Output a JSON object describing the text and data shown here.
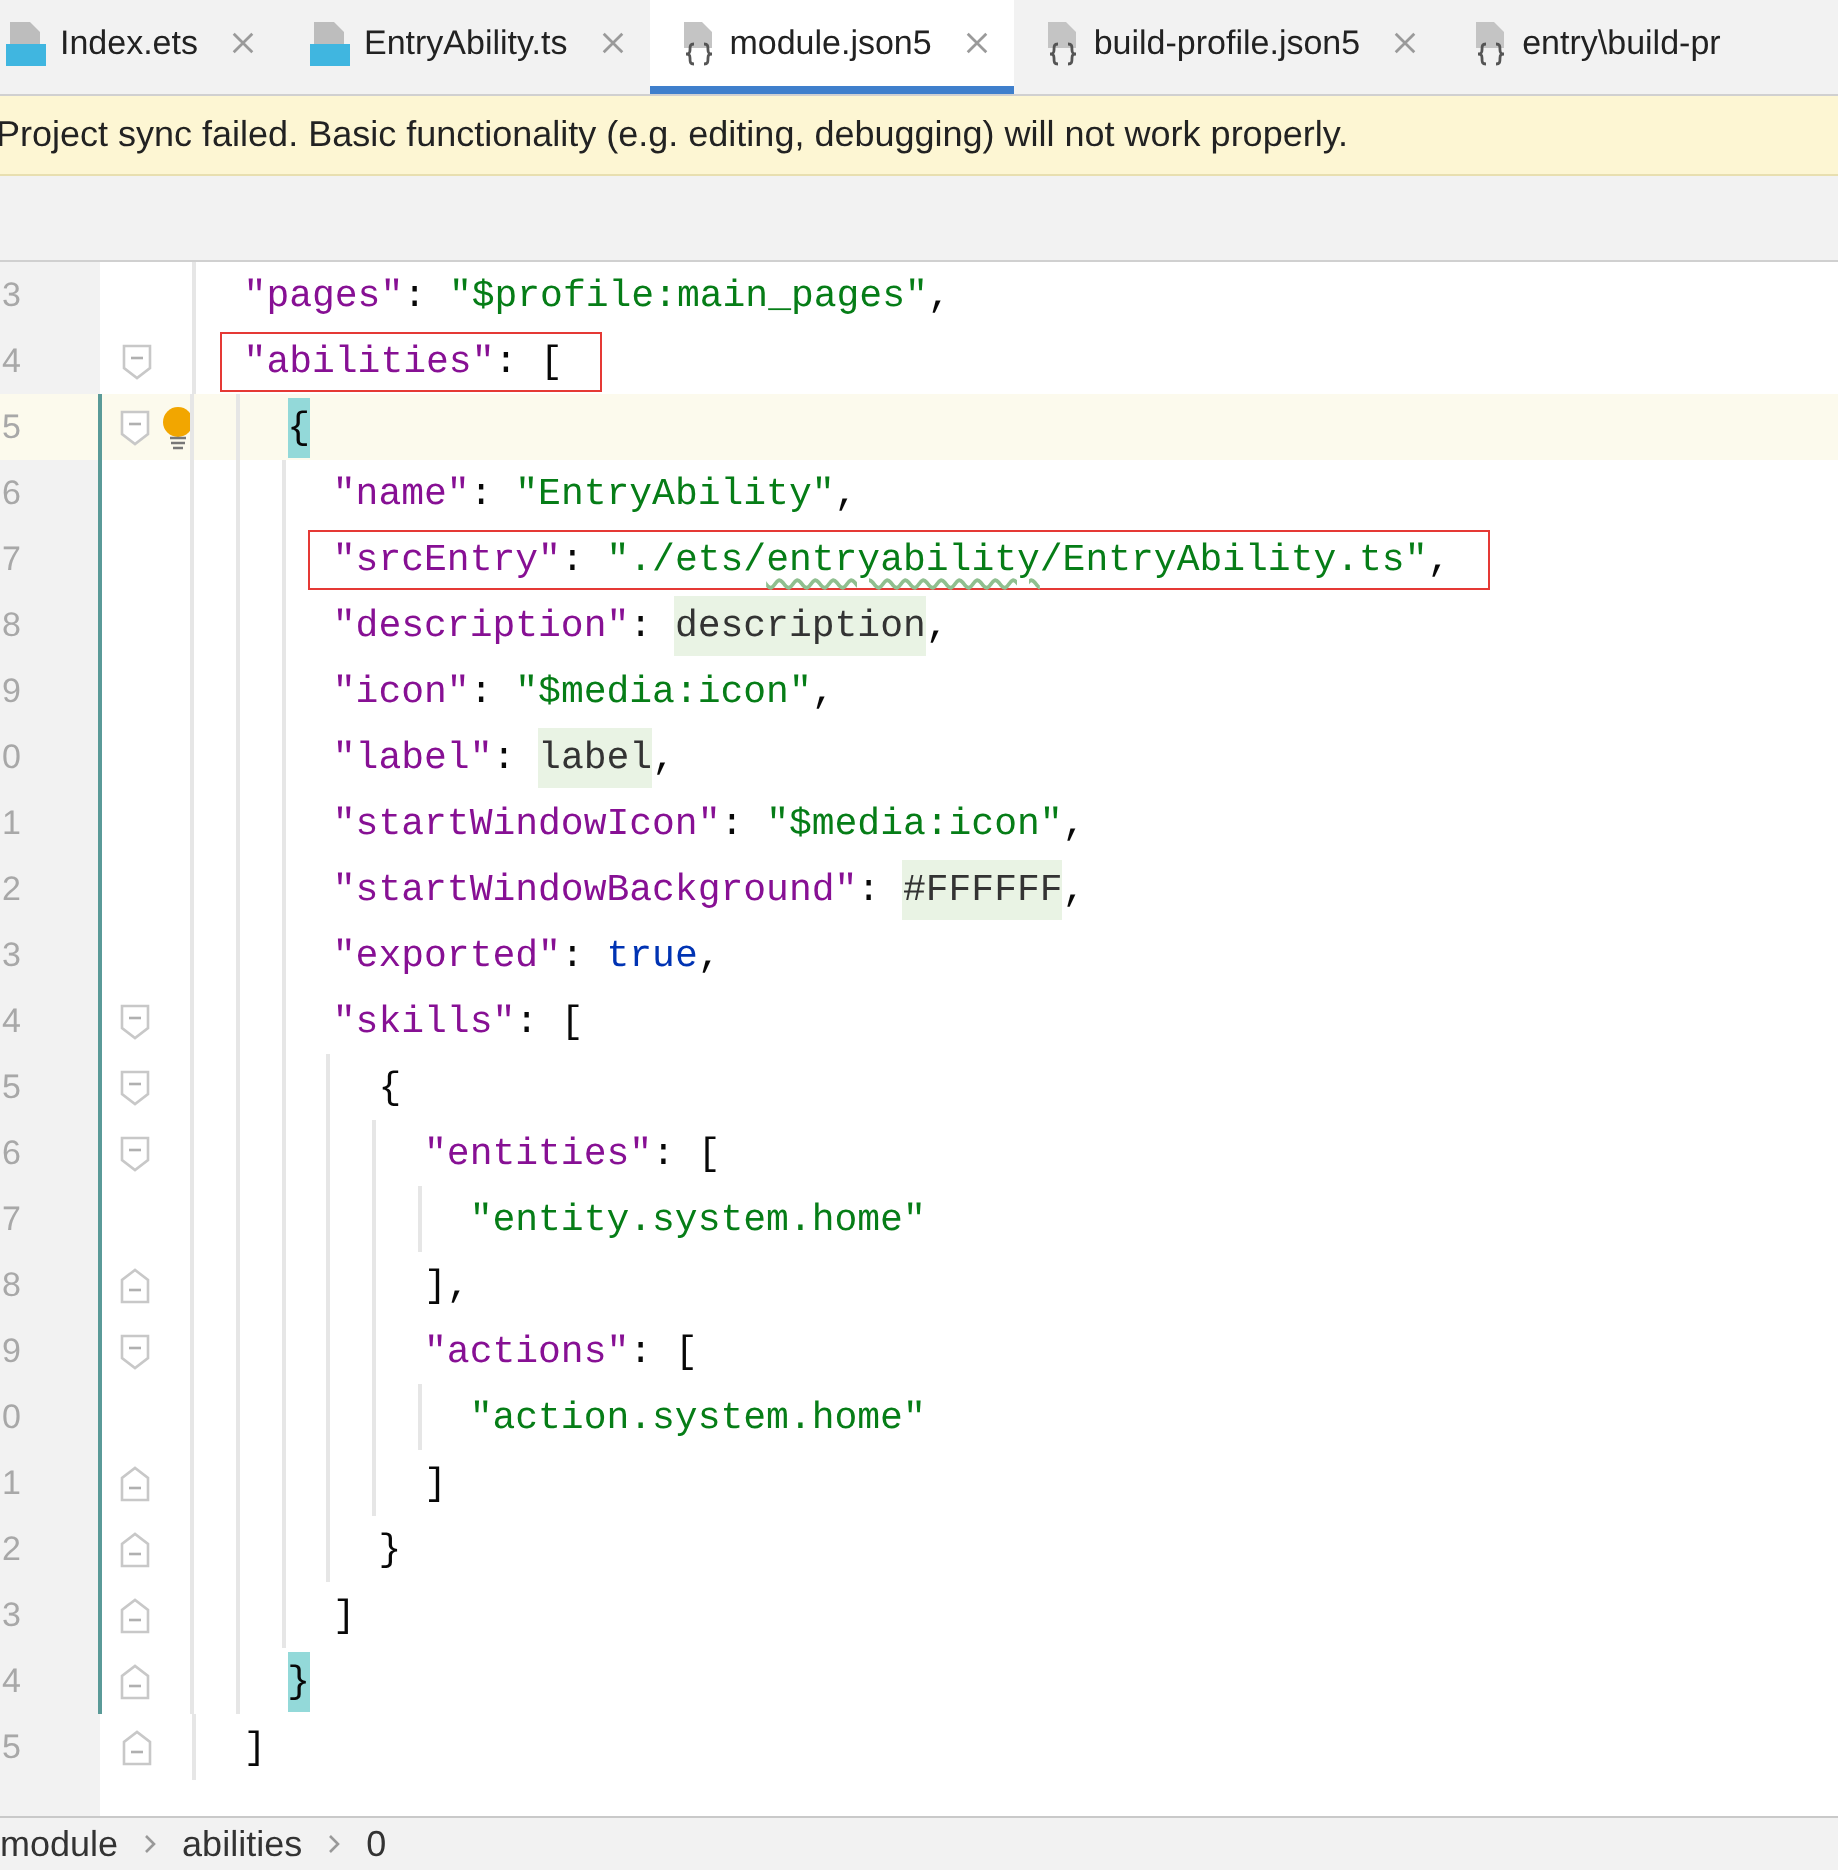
{
  "tabs": [
    {
      "label": "Index.ets",
      "kind": "ts",
      "selected": false,
      "closable": true
    },
    {
      "label": "EntryAbility.ts",
      "kind": "ts",
      "selected": false,
      "closable": true
    },
    {
      "label": "module.json5",
      "kind": "json",
      "selected": true,
      "closable": true
    },
    {
      "label": "build-profile.json5",
      "kind": "json",
      "selected": false,
      "closable": true
    },
    {
      "label": "entry\\build-pr",
      "kind": "json",
      "selected": false,
      "closable": false
    }
  ],
  "banner": {
    "text": "Project sync failed. Basic functionality (e.g. editing, debugging) will not work properly."
  },
  "editor": {
    "lines": [
      {
        "number": "3",
        "kind": "plain",
        "tokens": [
          {
            "kind": "key",
            "text": "\"pages\""
          },
          {
            "kind": "punct",
            "text": ": "
          },
          {
            "kind": "str",
            "text": "\"$profile:main_pages\""
          },
          {
            "kind": "punct",
            "text": ","
          }
        ]
      },
      {
        "number": "4",
        "kind": "fold-start",
        "boxed": true,
        "tokens": [
          {
            "kind": "key",
            "text": "\"abilities\""
          },
          {
            "kind": "punct",
            "text": ": ["
          }
        ],
        "children": [
          {
            "number": "5",
            "kind": "fold-start",
            "current": true,
            "bulb": true,
            "modified": true,
            "tokens": [
              {
                "kind": "match",
                "text": "{"
              }
            ],
            "children": [
              {
                "number": "6",
                "kind": "plain",
                "modified": true,
                "tokens": [
                  {
                    "kind": "key",
                    "text": "\"name\""
                  },
                  {
                    "kind": "punct",
                    "text": ": "
                  },
                  {
                    "kind": "str",
                    "text": "\"EntryAbility\""
                  },
                  {
                    "kind": "punct",
                    "text": ","
                  }
                ]
              },
              {
                "number": "7",
                "kind": "plain",
                "modified": true,
                "boxed": true,
                "tokens": [
                  {
                    "kind": "key",
                    "text": "\"srcEntry\""
                  },
                  {
                    "kind": "punct",
                    "text": ": "
                  },
                  {
                    "kind": "str",
                    "text": "\"./ets/"
                  },
                  {
                    "kind": "typo",
                    "text": "entryability"
                  },
                  {
                    "kind": "str",
                    "text": "/EntryAbility.ts\""
                  },
                  {
                    "kind": "punct",
                    "text": ","
                  }
                ]
              },
              {
                "number": "8",
                "kind": "plain",
                "modified": true,
                "tokens": [
                  {
                    "kind": "key",
                    "text": "\"description\""
                  },
                  {
                    "kind": "punct",
                    "text": ": "
                  },
                  {
                    "kind": "ref",
                    "text": "description"
                  },
                  {
                    "kind": "punct",
                    "text": ","
                  }
                ]
              },
              {
                "number": "9",
                "kind": "plain",
                "modified": true,
                "tokens": [
                  {
                    "kind": "key",
                    "text": "\"icon\""
                  },
                  {
                    "kind": "punct",
                    "text": ": "
                  },
                  {
                    "kind": "str",
                    "text": "\"$media:icon\""
                  },
                  {
                    "kind": "punct",
                    "text": ","
                  }
                ]
              },
              {
                "number": "0",
                "kind": "plain",
                "modified": true,
                "tokens": [
                  {
                    "kind": "key",
                    "text": "\"label\""
                  },
                  {
                    "kind": "punct",
                    "text": ": "
                  },
                  {
                    "kind": "ref",
                    "text": "label"
                  },
                  {
                    "kind": "punct",
                    "text": ","
                  }
                ]
              },
              {
                "number": "1",
                "kind": "plain",
                "modified": true,
                "tokens": [
                  {
                    "kind": "key",
                    "text": "\"startWindowIcon\""
                  },
                  {
                    "kind": "punct",
                    "text": ": "
                  },
                  {
                    "kind": "str",
                    "text": "\"$media:icon\""
                  },
                  {
                    "kind": "punct",
                    "text": ","
                  }
                ]
              },
              {
                "number": "2",
                "kind": "plain",
                "modified": true,
                "tokens": [
                  {
                    "kind": "key",
                    "text": "\"startWindowBackground\""
                  },
                  {
                    "kind": "punct",
                    "text": ": "
                  },
                  {
                    "kind": "ref",
                    "text": "#FFFFFF"
                  },
                  {
                    "kind": "punct",
                    "text": ","
                  }
                ]
              },
              {
                "number": "3",
                "kind": "plain",
                "modified": true,
                "tokens": [
                  {
                    "kind": "key",
                    "text": "\"exported\""
                  },
                  {
                    "kind": "punct",
                    "text": ": "
                  },
                  {
                    "kind": "kw",
                    "text": "true"
                  },
                  {
                    "kind": "punct",
                    "text": ","
                  }
                ]
              },
              {
                "number": "4",
                "kind": "fold-start",
                "modified": true,
                "tokens": [
                  {
                    "kind": "key",
                    "text": "\"skills\""
                  },
                  {
                    "kind": "punct",
                    "text": ": ["
                  }
                ],
                "children": [
                  {
                    "number": "5",
                    "kind": "fold-start",
                    "modified": true,
                    "tokens": [
                      {
                        "kind": "punct",
                        "text": "{"
                      }
                    ],
                    "children": [
                      {
                        "number": "6",
                        "kind": "fold-start",
                        "modified": true,
                        "tokens": [
                          {
                            "kind": "key",
                            "text": "\"entities\""
                          },
                          {
                            "kind": "punct",
                            "text": ": ["
                          }
                        ],
                        "children": [
                          {
                            "number": "7",
                            "kind": "plain",
                            "modified": true,
                            "tokens": [
                              {
                                "kind": "str",
                                "text": "\"entity.system.home\""
                              }
                            ]
                          }
                        ]
                      },
                      {
                        "number": "8",
                        "kind": "fold-end",
                        "modified": true,
                        "tokens": [
                          {
                            "kind": "punct",
                            "text": "],"
                          }
                        ]
                      },
                      {
                        "number": "9",
                        "kind": "fold-start",
                        "modified": true,
                        "tokens": [
                          {
                            "kind": "key",
                            "text": "\"actions\""
                          },
                          {
                            "kind": "punct",
                            "text": ": ["
                          }
                        ],
                        "children": [
                          {
                            "number": "0",
                            "kind": "plain",
                            "modified": true,
                            "tokens": [
                              {
                                "kind": "str",
                                "text": "\"action.system.home\""
                              }
                            ]
                          }
                        ]
                      },
                      {
                        "number": "1",
                        "kind": "fold-end",
                        "modified": true,
                        "tokens": [
                          {
                            "kind": "punct",
                            "text": "]"
                          }
                        ]
                      }
                    ]
                  },
                  {
                    "number": "2",
                    "kind": "fold-end",
                    "modified": true,
                    "tokens": [
                      {
                        "kind": "punct",
                        "text": "}"
                      }
                    ]
                  }
                ]
              },
              {
                "number": "3",
                "kind": "fold-end",
                "modified": true,
                "tokens": [
                  {
                    "kind": "punct",
                    "text": "]"
                  }
                ]
              }
            ]
          },
          {
            "number": "4",
            "kind": "fold-end",
            "modified": true,
            "tokens": [
              {
                "kind": "match",
                "text": "}"
              }
            ]
          }
        ]
      },
      {
        "number": "5",
        "kind": "fold-end",
        "tokens": [
          {
            "kind": "punct",
            "text": "]"
          }
        ]
      }
    ]
  },
  "breadcrumb": [
    "module",
    "abilities",
    "0"
  ]
}
